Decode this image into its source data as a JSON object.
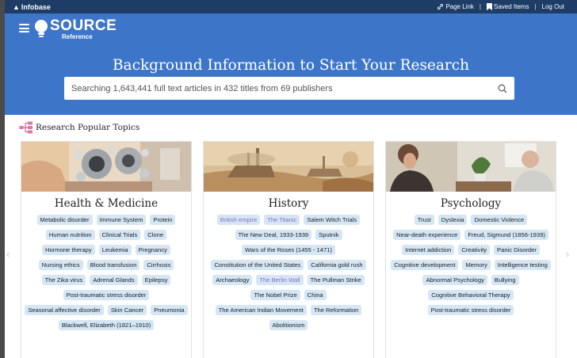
{
  "topbar": {
    "brand": {
      "bold": "Infobase",
      "light": ""
    },
    "links": [
      {
        "label": "Page Link",
        "icon": "link-icon"
      },
      {
        "label": "Saved Items",
        "icon": "bookmark-icon"
      },
      {
        "label": "Log Out",
        "icon": ""
      }
    ]
  },
  "hero": {
    "logo_main": "SOURCE",
    "logo_sub": "Reference",
    "title": "Background Information to Start Your Research",
    "search_placeholder": "Searching 1,643,441 full text articles in 432 titles from 69 publishers"
  },
  "section": {
    "title": "Research Popular Topics"
  },
  "cards": [
    {
      "title": "Health & Medicine",
      "tags": [
        {
          "label": "Metabolic disorder",
          "visited": false
        },
        {
          "label": "Immune System",
          "visited": false
        },
        {
          "label": "Protein",
          "visited": false
        },
        {
          "label": "Human nutrition",
          "visited": false
        },
        {
          "label": "Clinical Trials",
          "visited": false
        },
        {
          "label": "Clone",
          "visited": false
        },
        {
          "label": "Hormone therapy",
          "visited": false
        },
        {
          "label": "Leukemia",
          "visited": false
        },
        {
          "label": "Pregnancy",
          "visited": false
        },
        {
          "label": "Nursing ethics",
          "visited": false
        },
        {
          "label": "Blood transfusion",
          "visited": false
        },
        {
          "label": "Cirrhosis",
          "visited": false
        },
        {
          "label": "The Zika virus",
          "visited": false
        },
        {
          "label": "Adrenal Glands",
          "visited": false
        },
        {
          "label": "Epilepsy",
          "visited": false
        },
        {
          "label": "Post-traumatic stress disorder",
          "visited": false
        },
        {
          "label": "Seasonal affective disorder",
          "visited": false
        },
        {
          "label": "Skin Cancer",
          "visited": false
        },
        {
          "label": "Pneumonia",
          "visited": false
        },
        {
          "label": "Blackwell, Elizabeth (1821–1910)",
          "visited": false
        }
      ]
    },
    {
      "title": "History",
      "tags": [
        {
          "label": "British empire",
          "visited": true
        },
        {
          "label": "The Titanic",
          "visited": true
        },
        {
          "label": "Salem Witch Trials",
          "visited": false
        },
        {
          "label": "The New Deal, 1933-1939",
          "visited": false
        },
        {
          "label": "Sputnik",
          "visited": false
        },
        {
          "label": "Wars of the Roses (1455 - 1471)",
          "visited": false
        },
        {
          "label": "Constitution of the United States",
          "visited": false
        },
        {
          "label": "California gold rush",
          "visited": false
        },
        {
          "label": "Archaeology",
          "visited": false
        },
        {
          "label": "The Berlin Wall",
          "visited": true
        },
        {
          "label": "The Pullman Strike",
          "visited": false
        },
        {
          "label": "The Nobel Prize",
          "visited": false
        },
        {
          "label": "China",
          "visited": false
        },
        {
          "label": "The American Indian Movement",
          "visited": false
        },
        {
          "label": "The Reformation",
          "visited": false
        },
        {
          "label": "Abolitionism",
          "visited": false
        }
      ]
    },
    {
      "title": "Psychology",
      "tags": [
        {
          "label": "Trust",
          "visited": false
        },
        {
          "label": "Dyslexia",
          "visited": false
        },
        {
          "label": "Domestic Violence",
          "visited": false
        },
        {
          "label": "Near-death experience",
          "visited": false
        },
        {
          "label": "Freud, Sigmund (1856-1939)",
          "visited": false
        },
        {
          "label": "Internet addiction",
          "visited": false
        },
        {
          "label": "Creativity",
          "visited": false
        },
        {
          "label": "Panic Disorder",
          "visited": false
        },
        {
          "label": "Cognitive development",
          "visited": false
        },
        {
          "label": "Memory",
          "visited": false
        },
        {
          "label": "Intelligence testing",
          "visited": false
        },
        {
          "label": "Abnormal Psychology",
          "visited": false
        },
        {
          "label": "Bullying",
          "visited": false
        },
        {
          "label": "Cognitive Behavioral Therapy",
          "visited": false
        },
        {
          "label": "Post-traumatic stress disorder",
          "visited": false
        }
      ]
    }
  ],
  "arrows": {
    "prev": "‹",
    "next": "›"
  },
  "colors": {
    "topbar": "#1d3c66",
    "hero": "#3d75c9",
    "tag_bg": "#d5e6f5",
    "visited_text": "#8b6ec8"
  }
}
